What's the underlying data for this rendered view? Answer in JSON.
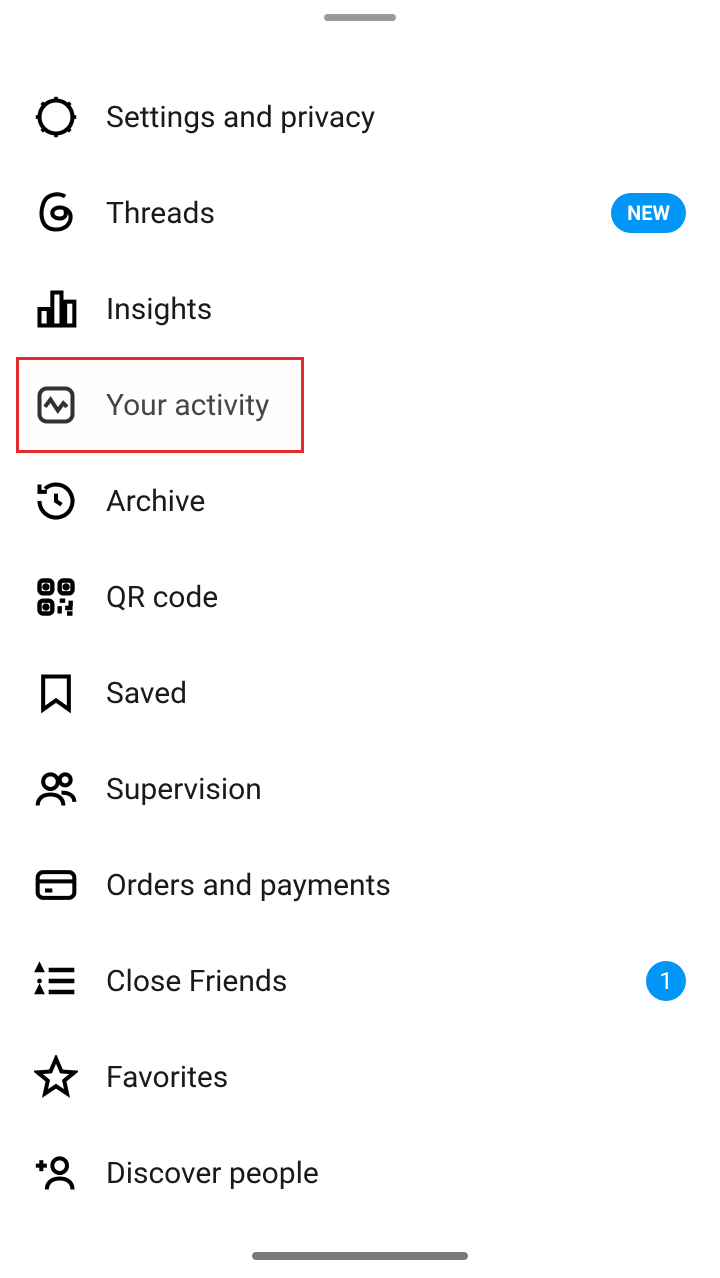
{
  "menu": {
    "items": [
      {
        "label": "Settings and privacy",
        "icon": "gear-icon",
        "badge": null
      },
      {
        "label": "Threads",
        "icon": "threads-icon",
        "badge": "NEW"
      },
      {
        "label": "Insights",
        "icon": "insights-icon",
        "badge": null
      },
      {
        "label": "Your activity",
        "icon": "activity-icon",
        "badge": null,
        "highlighted": true
      },
      {
        "label": "Archive",
        "icon": "archive-icon",
        "badge": null
      },
      {
        "label": "QR code",
        "icon": "qrcode-icon",
        "badge": null
      },
      {
        "label": "Saved",
        "icon": "saved-icon",
        "badge": null
      },
      {
        "label": "Supervision",
        "icon": "supervision-icon",
        "badge": null
      },
      {
        "label": "Orders and payments",
        "icon": "payments-icon",
        "badge": null
      },
      {
        "label": "Close Friends",
        "icon": "closefriends-icon",
        "badge": "1"
      },
      {
        "label": "Favorites",
        "icon": "favorites-icon",
        "badge": null
      },
      {
        "label": "Discover people",
        "icon": "discover-icon",
        "badge": null
      }
    ]
  },
  "colors": {
    "accent": "#0095f6",
    "highlight_border": "#e32b2b"
  }
}
